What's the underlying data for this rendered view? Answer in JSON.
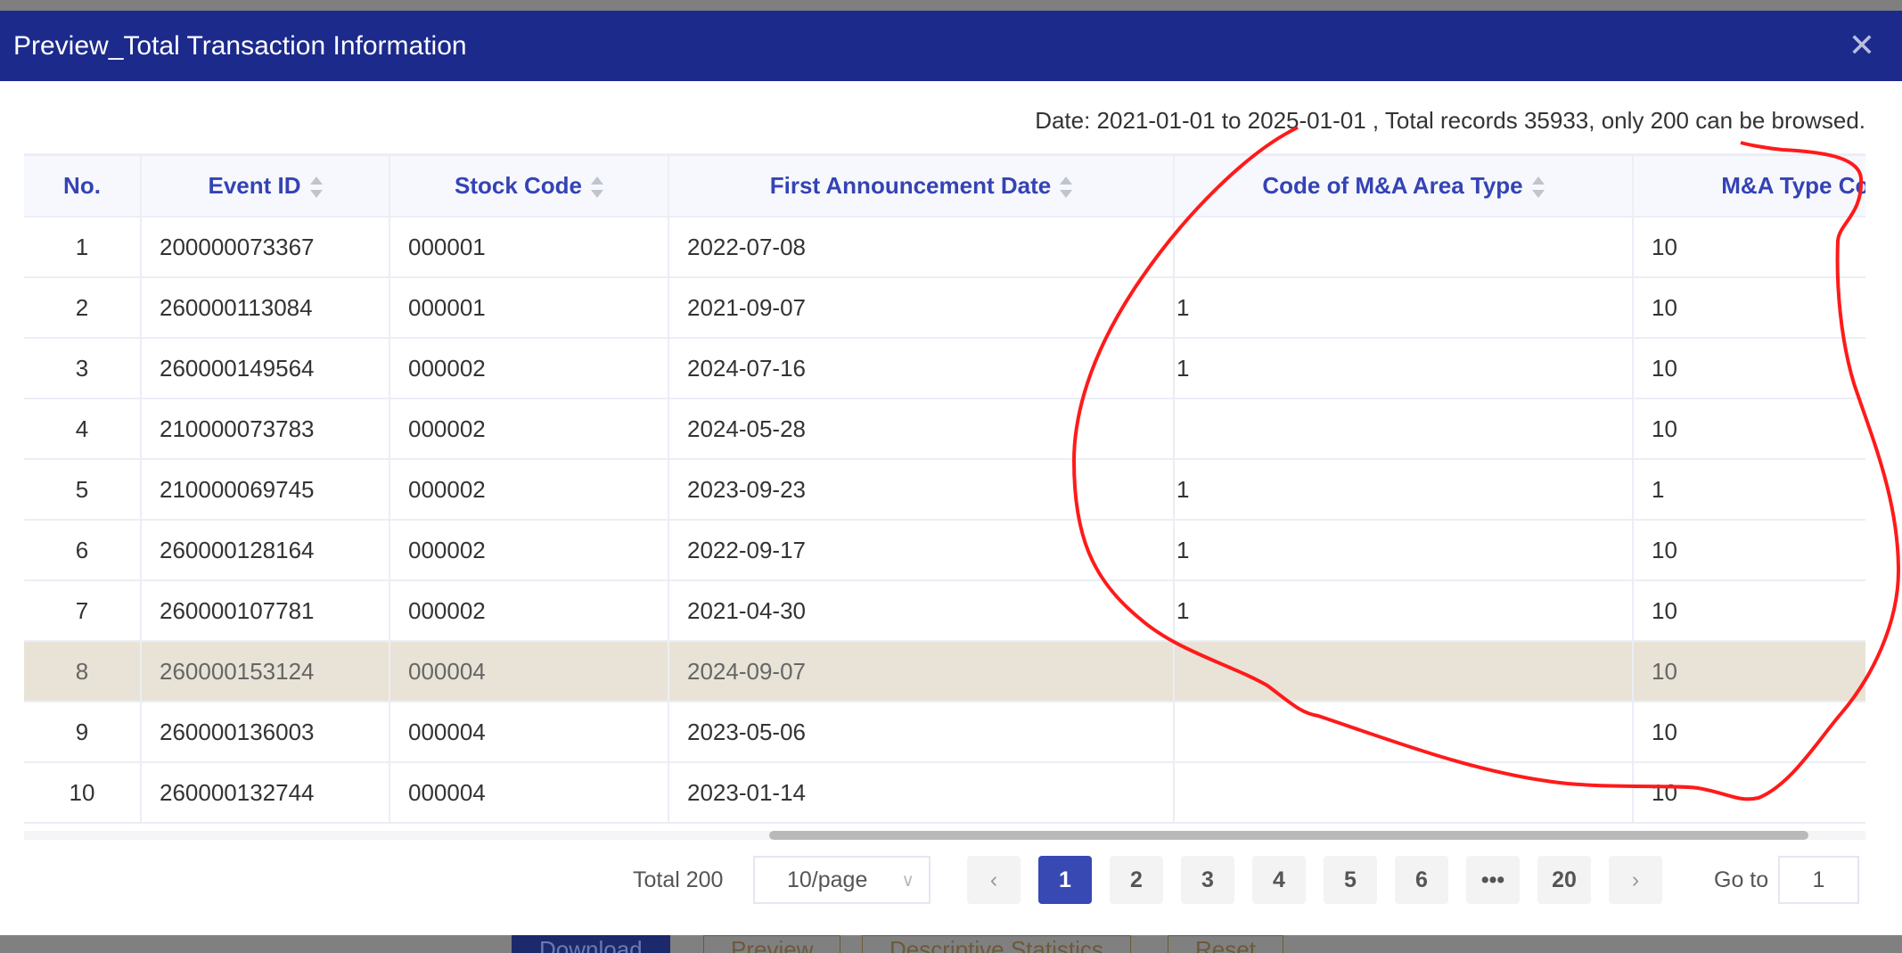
{
  "modal": {
    "title": "Preview_Total Transaction Information",
    "close_icon": "close-icon",
    "info": "Date: 2021-01-01 to 2025-01-01 , Total records 35933, only 200 can be browsed."
  },
  "table": {
    "columns": [
      "No.",
      "Event ID",
      "Stock Code",
      "First Announcement Date",
      "Code of M&A Area Type",
      "M&A Type Code"
    ],
    "rows": [
      [
        "1",
        "200000073367",
        "000001",
        "2022-07-08",
        "",
        "10"
      ],
      [
        "2",
        "260000113084",
        "000001",
        "2021-09-07",
        "1",
        "10"
      ],
      [
        "3",
        "260000149564",
        "000002",
        "2024-07-16",
        "1",
        "10"
      ],
      [
        "4",
        "210000073783",
        "000002",
        "2024-05-28",
        "",
        "10"
      ],
      [
        "5",
        "210000069745",
        "000002",
        "2023-09-23",
        "1",
        "1"
      ],
      [
        "6",
        "260000128164",
        "000002",
        "2022-09-17",
        "1",
        "10"
      ],
      [
        "7",
        "260000107781",
        "000002",
        "2021-04-30",
        "1",
        "10"
      ],
      [
        "8",
        "260000153124",
        "000004",
        "2024-09-07",
        "",
        "10"
      ],
      [
        "9",
        "260000136003",
        "000004",
        "2023-05-06",
        "",
        "10"
      ],
      [
        "10",
        "260000132744",
        "000004",
        "2023-01-14",
        "",
        "10"
      ]
    ],
    "highlighted_row": 8
  },
  "pagination": {
    "total": "Total 200",
    "page_size": "10/page",
    "pages": [
      "1",
      "2",
      "3",
      "4",
      "5",
      "6",
      "•••",
      "20"
    ],
    "current": "1",
    "prev": "‹",
    "next": "›",
    "goto_label": "Go to",
    "goto_value": "1"
  },
  "background_buttons": [
    "Download",
    "Preview",
    "Descriptive Statistics",
    "Reset"
  ],
  "colors": {
    "header": "#1c2a8c",
    "accent": "#3849b3",
    "annotation": "#ff1a1a",
    "highlight": "#e8e3d6"
  }
}
